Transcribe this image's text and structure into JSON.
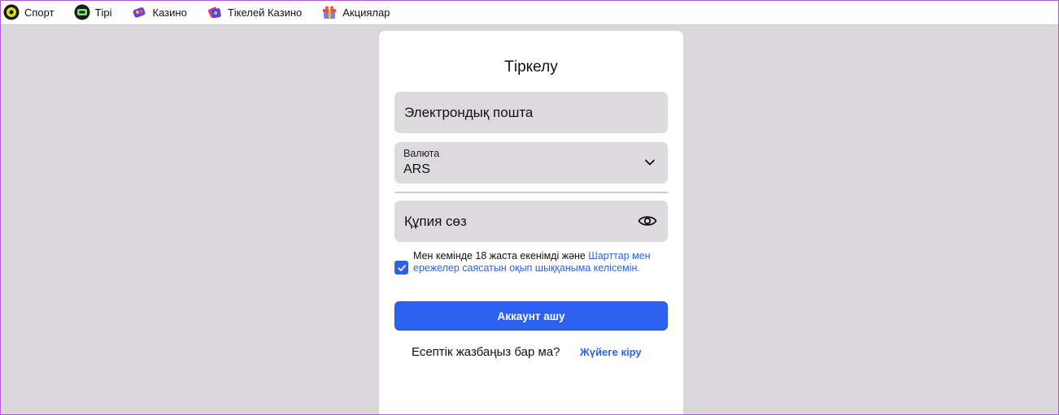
{
  "nav": {
    "items": [
      {
        "label": "Спорт",
        "icon": "soccer-ball-icon"
      },
      {
        "label": "Тірі",
        "icon": "live-tv-icon"
      },
      {
        "label": "Казино",
        "icon": "slot-machine-icon"
      },
      {
        "label": "Тікелей Казино",
        "icon": "casino-chips-icon"
      },
      {
        "label": "Акциялар",
        "icon": "gift-box-icon"
      }
    ]
  },
  "form": {
    "title": "Тіркелу",
    "email_placeholder": "Электрондық пошта",
    "currency_label": "Валюта",
    "currency_value": "ARS",
    "password_placeholder": "Құпия сөз",
    "agree_text_plain": "Мен кемінде 18 жаста екенімді және ",
    "agree_text_link": "Шарттар мен ережелер саясатын оқып шыққаныма келісемін.",
    "agree_checked": true,
    "submit_label": "Аккаунт ашу",
    "have_account_text": "Есептік жазбаңыз бар ма?",
    "login_link": "Жүйеге кіру"
  },
  "colors": {
    "accent": "#2d62f0",
    "link": "#2d62e6",
    "background": "#d9d7da",
    "field": "#dcdadd"
  }
}
